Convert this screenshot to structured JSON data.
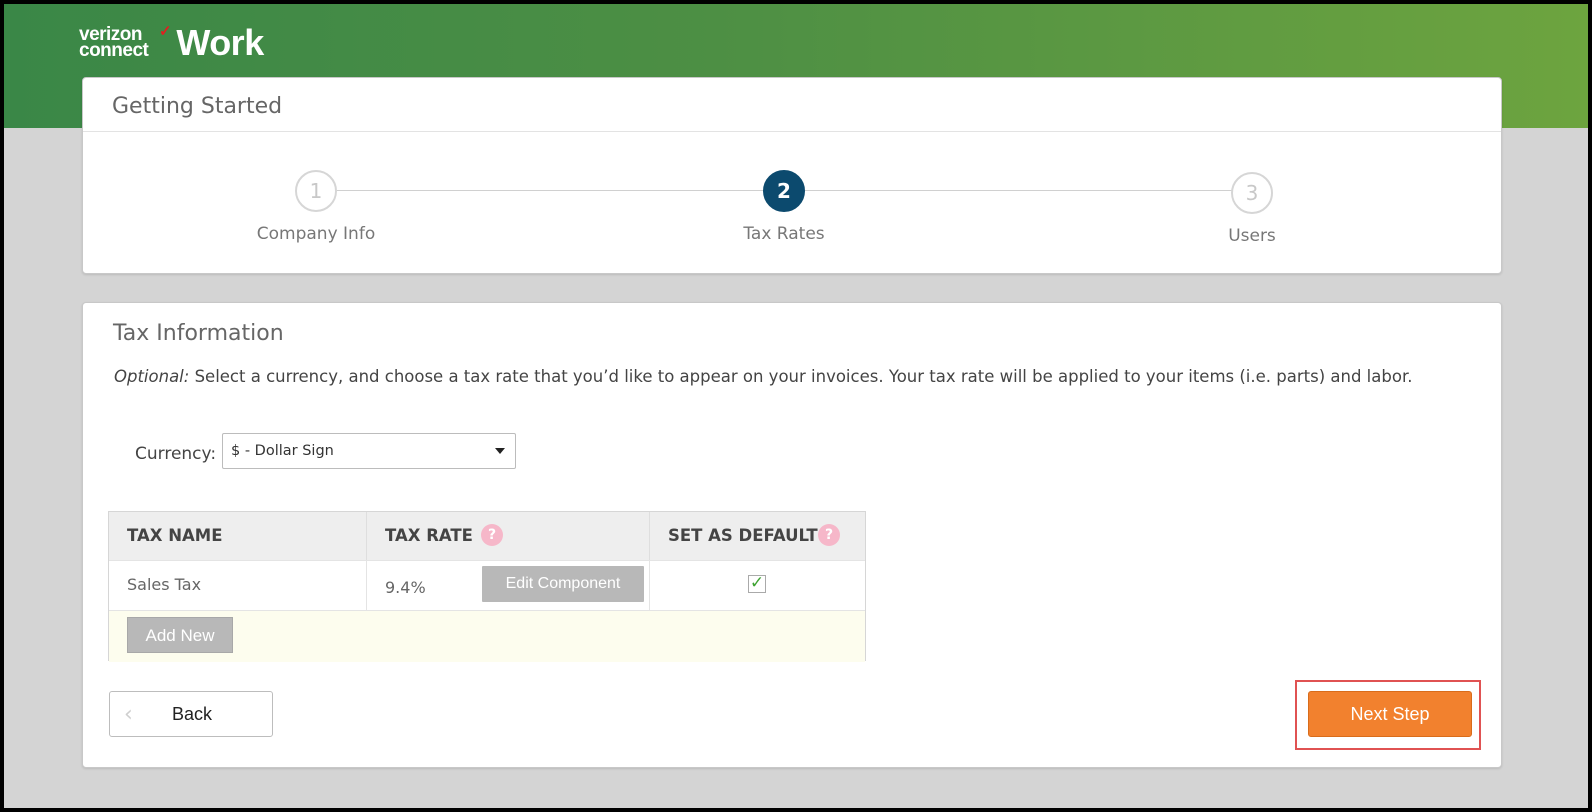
{
  "header": {
    "logo_line1": "verizon",
    "logo_line2": "connect",
    "logo_mark": "✓",
    "product": "Work"
  },
  "wizard": {
    "title": "Getting Started",
    "steps": [
      {
        "number": "1",
        "label": "Company Info",
        "state": "inactive"
      },
      {
        "number": "2",
        "label": "Tax Rates",
        "state": "active"
      },
      {
        "number": "3",
        "label": "Users",
        "state": "inactive"
      }
    ]
  },
  "tax": {
    "title": "Tax Information",
    "desc_optional": "Optional:",
    "desc_text": " Select a currency, and choose a tax rate that you’d like to appear on your invoices. Your tax rate will be applied to your items (i.e. parts) and labor.",
    "currency_label": "Currency:",
    "currency_value": "$ - Dollar Sign",
    "table": {
      "headers": [
        "TAX NAME",
        "TAX RATE",
        "SET AS DEFAULT"
      ],
      "help_icon": "?",
      "rows": [
        {
          "name": "Sales Tax",
          "rate": "9.4%",
          "edit_label": "Edit Component",
          "default_checked": true,
          "check_glyph": "✓"
        }
      ],
      "add_label": "Add New"
    }
  },
  "nav": {
    "back_label": "Back",
    "back_icon": "‹",
    "next_label": "Next Step"
  },
  "colors": {
    "header_green": "#3a8747",
    "active_step": "#0c4a6e",
    "next_orange": "#f2812e",
    "highlight_red": "#e05252",
    "help_pink": "#f6b7c9"
  }
}
